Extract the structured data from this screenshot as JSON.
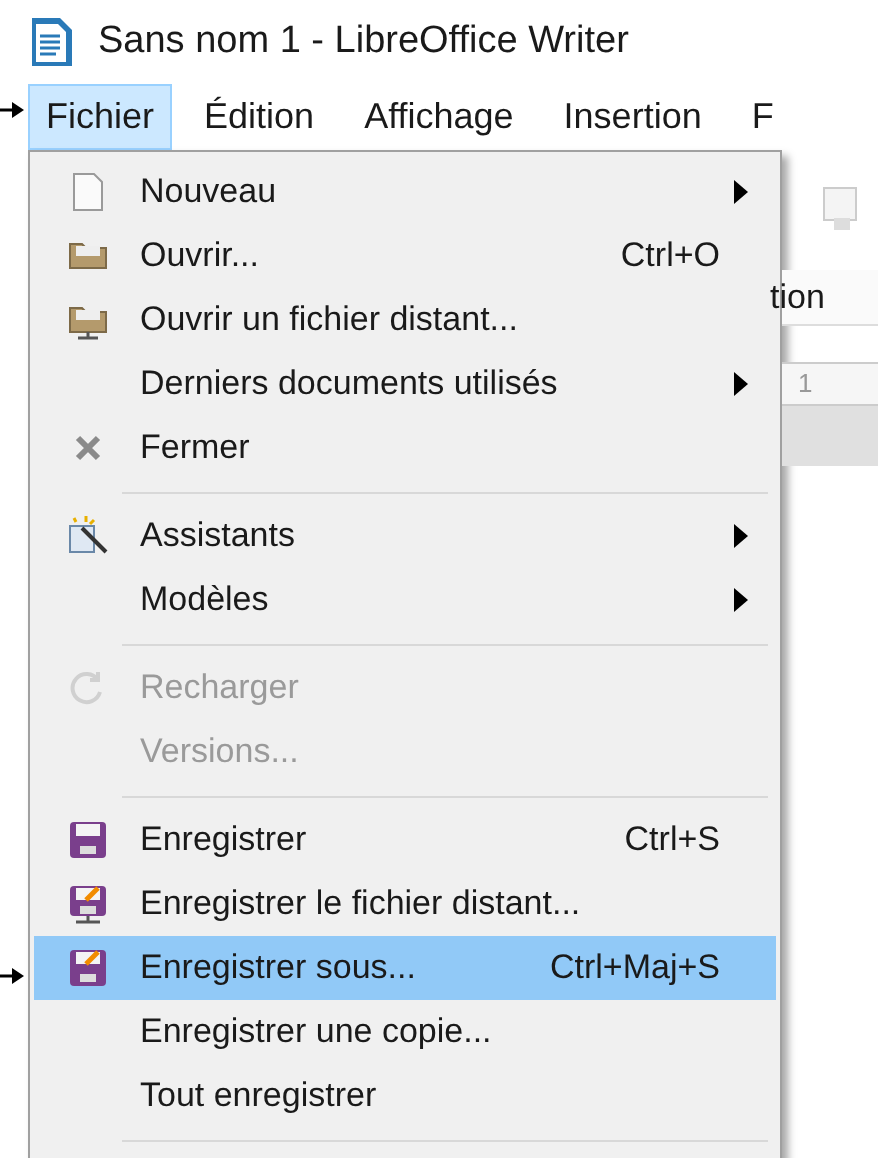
{
  "window": {
    "title": "Sans nom 1 - LibreOffice Writer"
  },
  "menubar": [
    {
      "label": "Fichier",
      "selected": true
    },
    {
      "label": "Édition",
      "selected": false
    },
    {
      "label": "Affichage",
      "selected": false
    },
    {
      "label": "Insertion",
      "selected": false
    },
    {
      "label": "F",
      "selected": false
    }
  ],
  "background": {
    "toolbar_text": "tion",
    "ruler_number": "1"
  },
  "menu": [
    {
      "kind": "item",
      "label": "Nouveau",
      "submenu": true,
      "disabled": false,
      "selected": false
    },
    {
      "kind": "item",
      "label": "Ouvrir...",
      "shortcut": "Ctrl+O",
      "submenu": false,
      "disabled": false,
      "selected": false
    },
    {
      "kind": "item",
      "label": "Ouvrir un fichier distant...",
      "submenu": false,
      "disabled": false,
      "selected": false
    },
    {
      "kind": "item",
      "label": "Derniers documents utilisés",
      "submenu": true,
      "disabled": false,
      "selected": false
    },
    {
      "kind": "item",
      "label": "Fermer",
      "submenu": false,
      "disabled": false,
      "selected": false
    },
    {
      "kind": "separator"
    },
    {
      "kind": "item",
      "label": "Assistants",
      "submenu": true,
      "disabled": false,
      "selected": false
    },
    {
      "kind": "item",
      "label": "Modèles",
      "submenu": true,
      "disabled": false,
      "selected": false
    },
    {
      "kind": "separator"
    },
    {
      "kind": "item",
      "label": "Recharger",
      "submenu": false,
      "disabled": true,
      "selected": false
    },
    {
      "kind": "item",
      "label": "Versions...",
      "submenu": false,
      "disabled": true,
      "selected": false
    },
    {
      "kind": "separator"
    },
    {
      "kind": "item",
      "label": "Enregistrer",
      "shortcut": "Ctrl+S",
      "submenu": false,
      "disabled": false,
      "selected": false
    },
    {
      "kind": "item",
      "label": "Enregistrer le fichier distant...",
      "submenu": false,
      "disabled": false,
      "selected": false
    },
    {
      "kind": "item",
      "label": "Enregistrer sous...",
      "shortcut": "Ctrl+Maj+S",
      "submenu": false,
      "disabled": false,
      "selected": true
    },
    {
      "kind": "item",
      "label": "Enregistrer une copie...",
      "submenu": false,
      "disabled": false,
      "selected": false
    },
    {
      "kind": "item",
      "label": "Tout enregistrer",
      "submenu": false,
      "disabled": false,
      "selected": false
    },
    {
      "kind": "separator"
    }
  ]
}
